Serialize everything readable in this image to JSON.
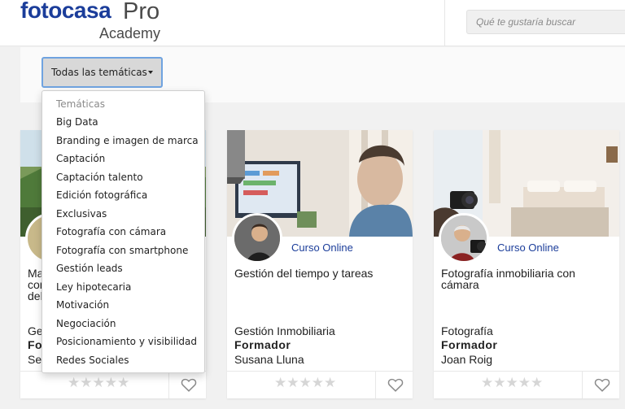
{
  "header": {
    "brand": "fotocasa",
    "brand_pro": "Pro",
    "brand_sub": "Academy",
    "search_placeholder": "Qué te gustaría buscar"
  },
  "filter": {
    "selected": "Todas las temáticas",
    "menu_header": "Temáticas",
    "options": [
      "Big Data",
      "Branding e imagen de marca",
      "Captación",
      "Captación talento",
      "Edición fotográfica",
      "Exclusivas",
      "Fotografía con cámara",
      "Fotografía con smartphone",
      "Gestión leads",
      "Ley hipotecaria",
      "Motivación",
      "Negociación",
      "Posicionamiento y visibilidad",
      "Redes Sociales"
    ]
  },
  "cards": [
    {
      "course_type": "",
      "title": "Ma\ncon\ndel",
      "category": "Gest",
      "role": "For",
      "name": "Ser",
      "rating": 0,
      "stars": "★★★★★"
    },
    {
      "course_type": "Curso Online",
      "title": "Gestión del tiempo y tareas",
      "category": "Gestión Inmobiliaria",
      "role": "Formador",
      "name": "Susana Lluna",
      "rating": 0,
      "stars": "★★★★★"
    },
    {
      "course_type": "Curso Online",
      "title": "Fotografía inmobiliaria con cámara",
      "category": "Fotografía",
      "role": "Formador",
      "name": "Joan Roig",
      "rating": 0,
      "stars": "★★★★★"
    }
  ],
  "colors": {
    "brand": "#1b3d9a",
    "focus_ring": "#6fa3e0",
    "star_empty": "#d6d6d6"
  }
}
